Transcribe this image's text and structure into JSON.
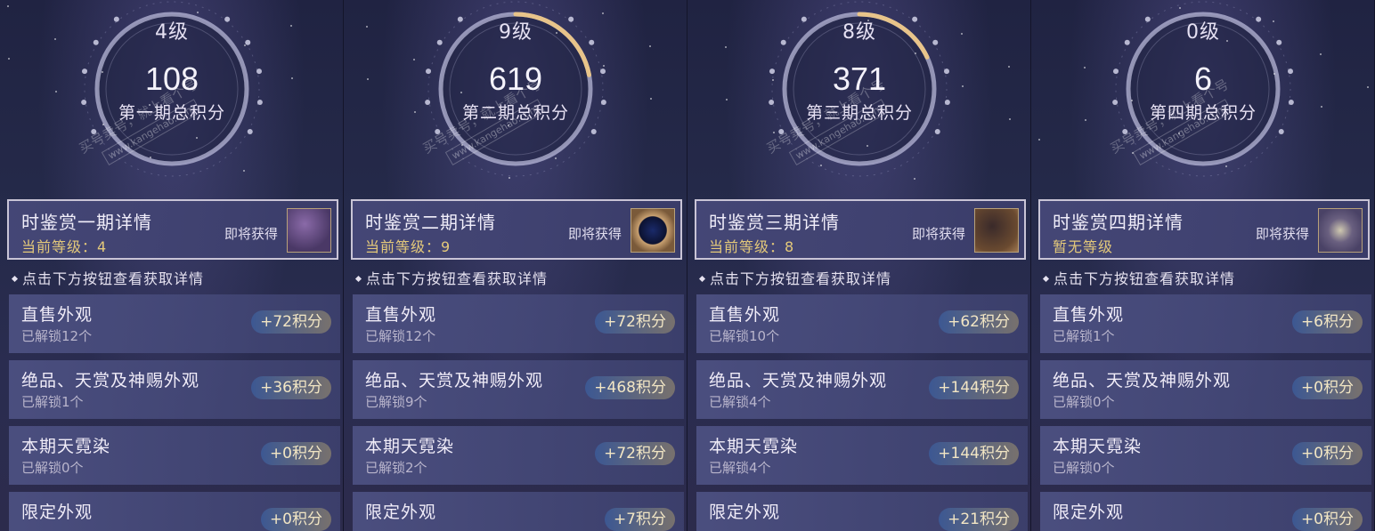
{
  "panels": [
    {
      "level": "4级",
      "score": "108",
      "score_label": "第一期总积分",
      "progress": 0.0,
      "detail_title": "时鉴赏一期详情",
      "detail_level": "当前等级：4",
      "reward_label": "即将获得",
      "hint": "点击下方按钮查看获取详情",
      "rows": [
        {
          "title": "直售外观",
          "sub": "已解锁12个",
          "badge": "+72积分"
        },
        {
          "title": "绝品、天赏及神赐外观",
          "sub": "已解锁1个",
          "badge": "+36积分"
        },
        {
          "title": "本期天霓染",
          "sub": "已解锁0个",
          "badge": "+0积分"
        },
        {
          "title": "限定外观",
          "sub": "",
          "badge": "+0积分"
        }
      ]
    },
    {
      "level": "9级",
      "score": "619",
      "score_label": "第二期总积分",
      "progress": 0.22,
      "detail_title": "时鉴赏二期详情",
      "detail_level": "当前等级：9",
      "reward_label": "即将获得",
      "hint": "点击下方按钮查看获取详情",
      "rows": [
        {
          "title": "直售外观",
          "sub": "已解锁12个",
          "badge": "+72积分"
        },
        {
          "title": "绝品、天赏及神赐外观",
          "sub": "已解锁9个",
          "badge": "+468积分"
        },
        {
          "title": "本期天霓染",
          "sub": "已解锁2个",
          "badge": "+72积分"
        },
        {
          "title": "限定外观",
          "sub": "",
          "badge": "+7积分"
        }
      ]
    },
    {
      "level": "8级",
      "score": "371",
      "score_label": "第三期总积分",
      "progress": 0.18,
      "detail_title": "时鉴赏三期详情",
      "detail_level": "当前等级：8",
      "reward_label": "即将获得",
      "hint": "点击下方按钮查看获取详情",
      "rows": [
        {
          "title": "直售外观",
          "sub": "已解锁10个",
          "badge": "+62积分"
        },
        {
          "title": "绝品、天赏及神赐外观",
          "sub": "已解锁4个",
          "badge": "+144积分"
        },
        {
          "title": "本期天霓染",
          "sub": "已解锁4个",
          "badge": "+144积分"
        },
        {
          "title": "限定外观",
          "sub": "",
          "badge": "+21积分"
        }
      ]
    },
    {
      "level": "0级",
      "score": "6",
      "score_label": "第四期总积分",
      "progress": 0.0,
      "detail_title": "时鉴赏四期详情",
      "detail_level": "暂无等级",
      "reward_label": "即将获得",
      "hint": "点击下方按钮查看获取详情",
      "rows": [
        {
          "title": "直售外观",
          "sub": "已解锁1个",
          "badge": "+6积分"
        },
        {
          "title": "绝品、天赏及神赐外观",
          "sub": "已解锁0个",
          "badge": "+0积分"
        },
        {
          "title": "本期天霓染",
          "sub": "已解锁0个",
          "badge": "+0积分"
        },
        {
          "title": "限定外观",
          "sub": "",
          "badge": "+0积分"
        }
      ]
    }
  ],
  "watermark": {
    "text": "买号卖号，就上看个号",
    "url": "www.kangehao.com",
    "brand": "看个号"
  },
  "colors": {
    "level_text": "#e4c97a",
    "progress_arc": "#e8c48a",
    "badge_text": "#f2e6c4"
  },
  "reward_thumbs": [
    "purple-frame",
    "blue-orb",
    "bronze-frame",
    "bird-ornament"
  ]
}
